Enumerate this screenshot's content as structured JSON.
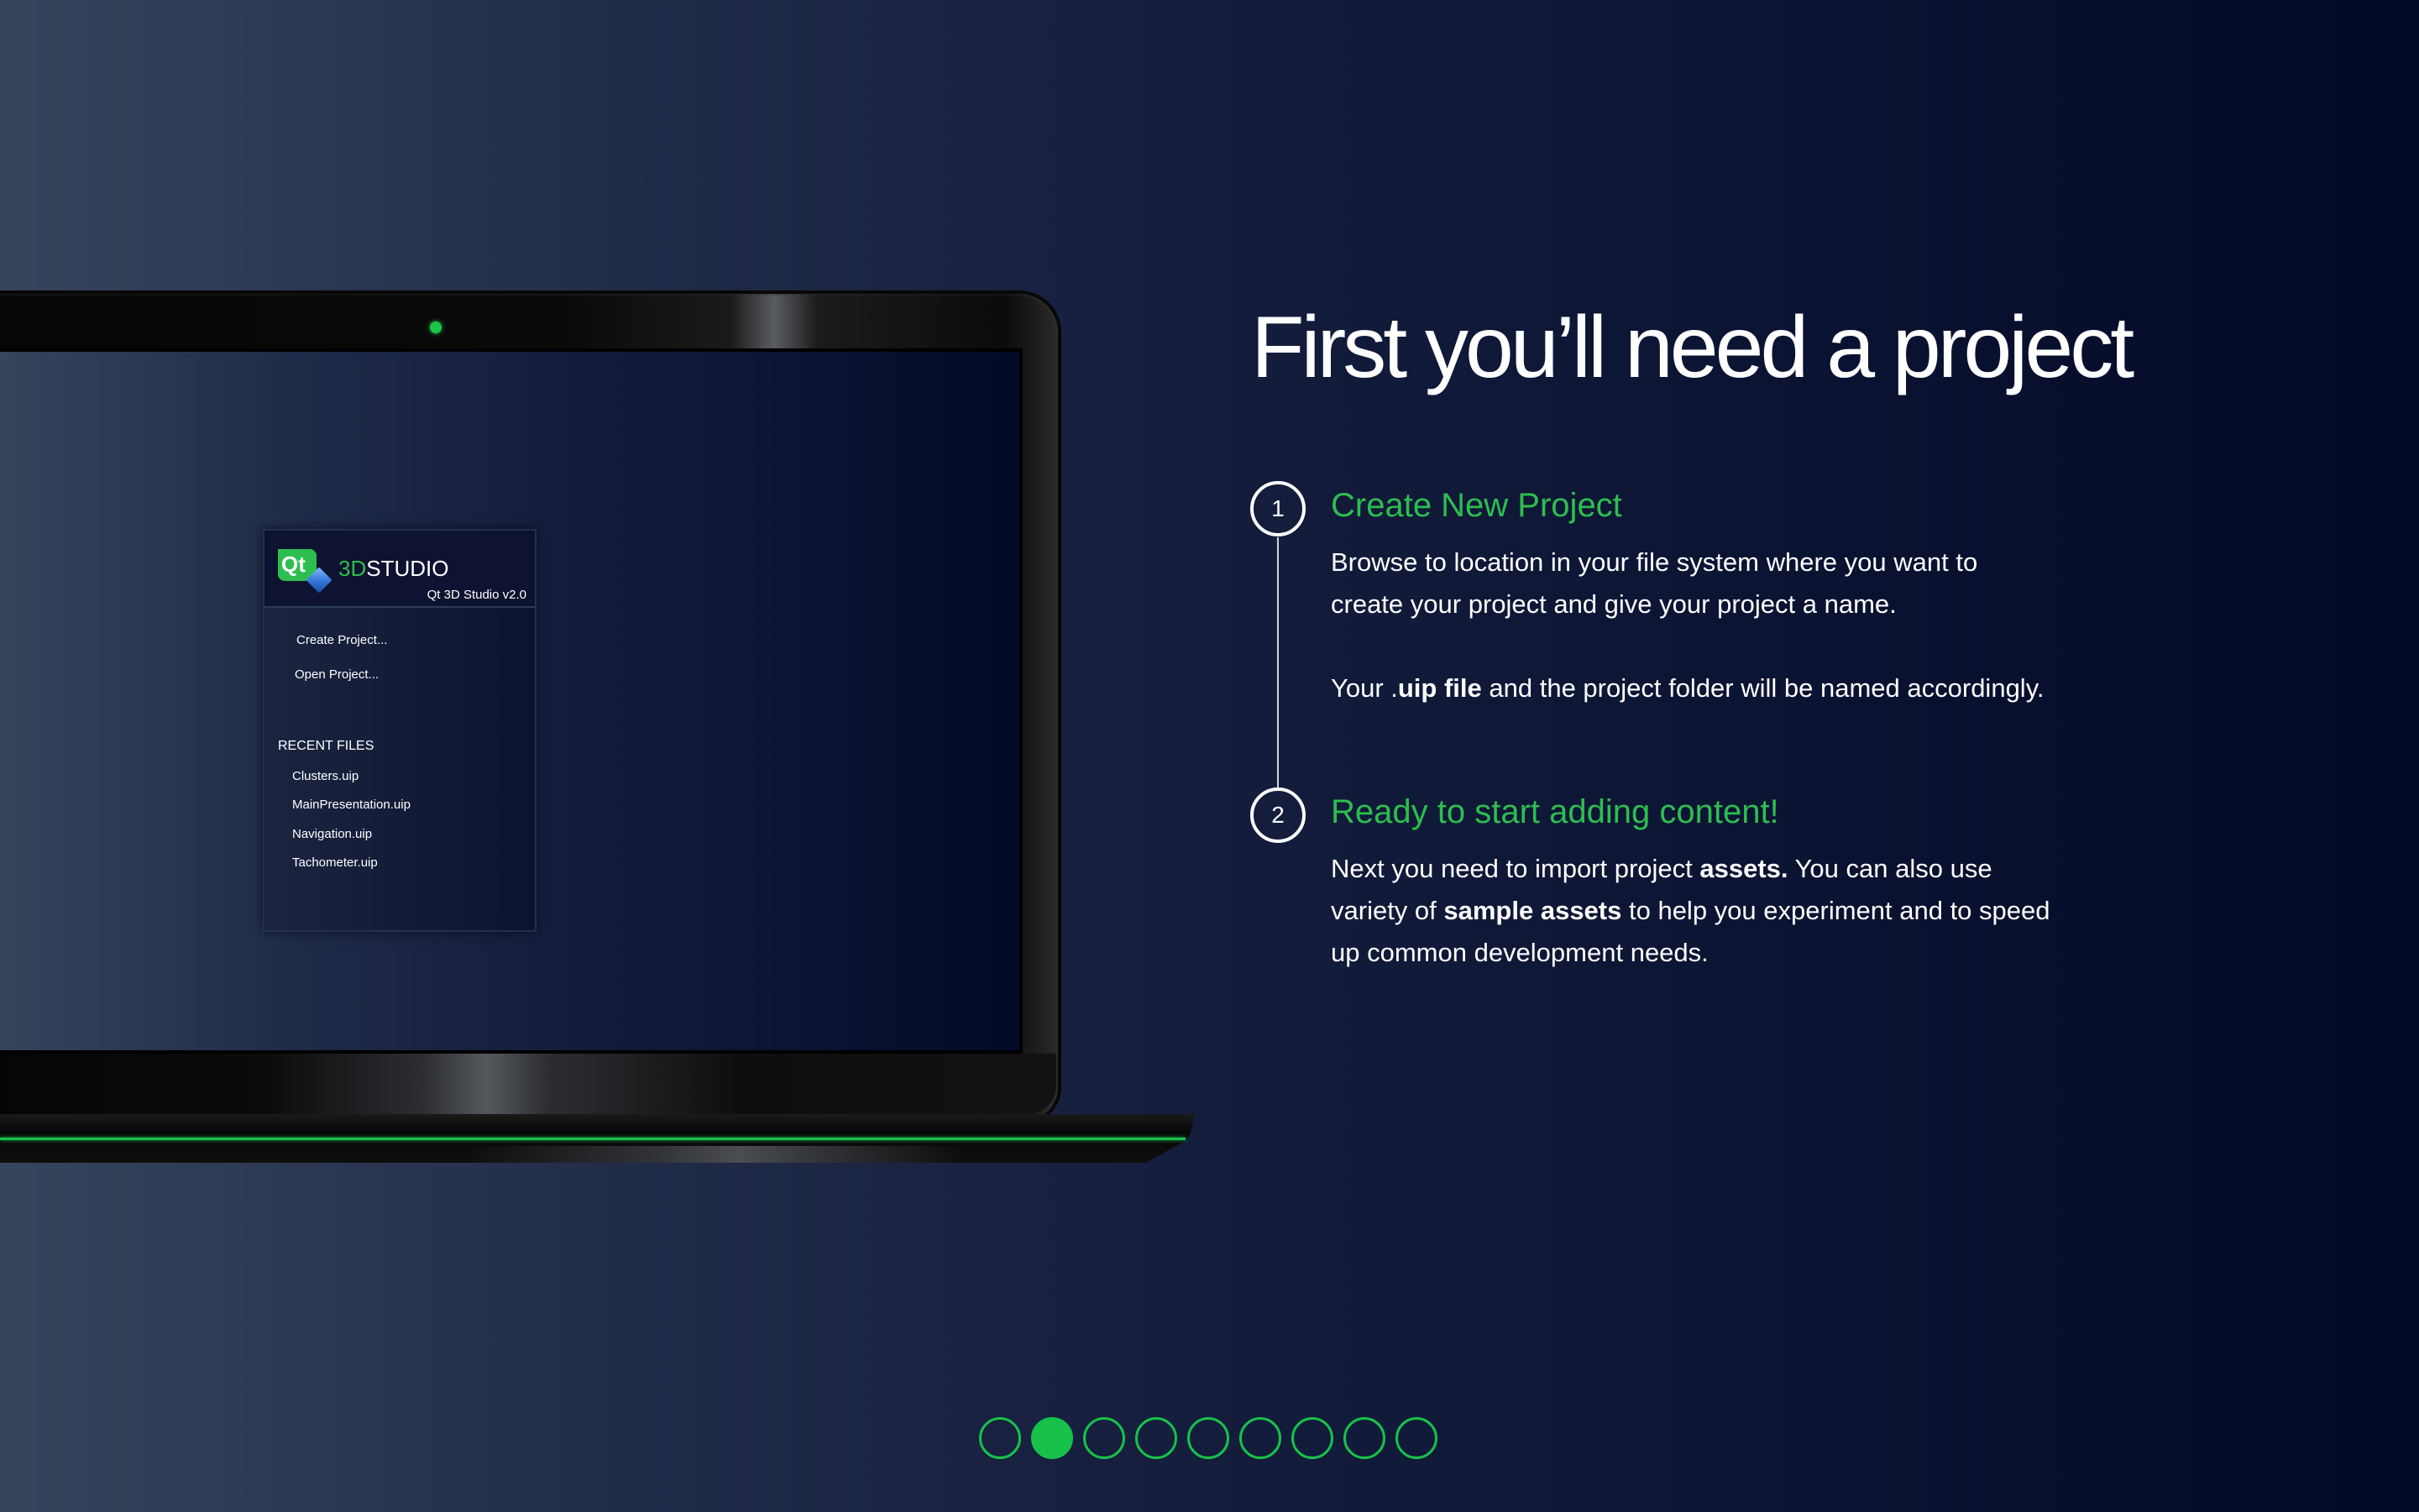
{
  "slide": {
    "title": "First you’ll need a project"
  },
  "laptop_screen": {
    "studio_prefix": "3D",
    "studio_suffix": "STUDIO",
    "logo_text": "Qt",
    "version": "Qt 3D Studio v2.0",
    "actions": [
      "Create Project...",
      "Open Project..."
    ],
    "recent_heading": "RECENT FILES",
    "recent_files": [
      "Clusters.uip",
      "MainPresentation.uip",
      "Navigation.uip",
      "Tachometer.uip"
    ]
  },
  "steps": [
    {
      "number": "1",
      "title": "Create New Project",
      "text_line1": "Browse to location in your file system where you  want to",
      "text_line2": "create your project and give your project a name.",
      "text_p2_pre": "Your .",
      "text_p2_bold": "uip file",
      "text_p2_post": " and the project folder will be named accordingly."
    },
    {
      "number": "2",
      "title": "Ready to start adding content!",
      "text_l1_pre": "Next you need to import project ",
      "text_l1_bold": "assets.",
      "text_l1_post": " You can also use",
      "text_l2_pre": "variety of ",
      "text_l2_bold": "sample assets",
      "text_l2_post": " to help you experiment and to speed",
      "text_l3": "up common development needs."
    }
  ],
  "pager": {
    "total_pages": 9,
    "current_page": 2
  },
  "colors": {
    "accent_green": "#2dbe4f",
    "background_dark": "#020a26",
    "background_light": "#36445c"
  }
}
